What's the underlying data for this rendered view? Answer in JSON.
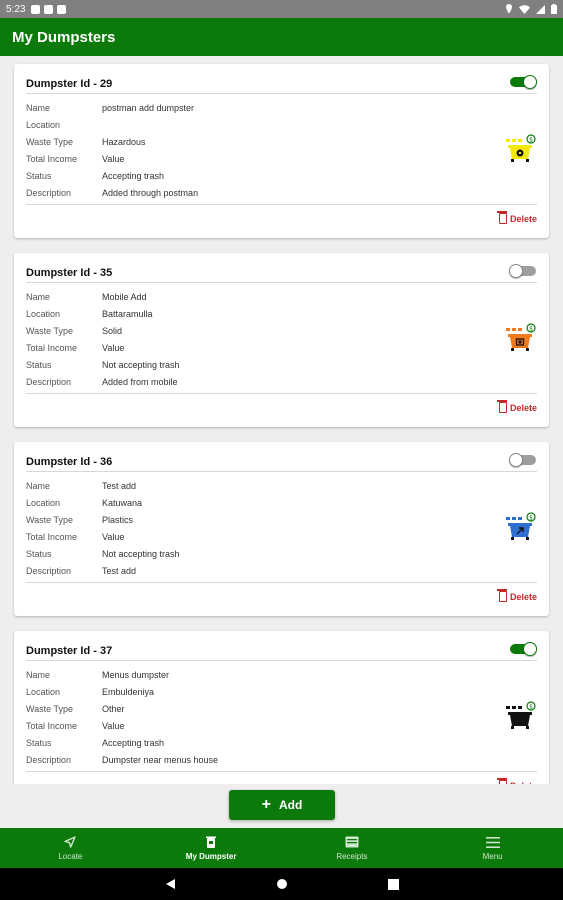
{
  "status_bar": {
    "time": "5:23"
  },
  "app_bar": {
    "title": "My Dumpsters"
  },
  "field_labels": {
    "name": "Name",
    "location": "Location",
    "waste_type": "Waste Type",
    "total_income": "Total Income",
    "status": "Status",
    "description": "Description"
  },
  "delete_label": "Delete",
  "dumpsters": [
    {
      "title": "Dumpster Id - 29",
      "enabled": true,
      "name": "postman add dumpster",
      "location": "",
      "waste_type": "Hazardous",
      "total_income": "Value",
      "status": "Accepting trash",
      "description": "Added through postman",
      "icon": "hazardous-dumpster-icon",
      "color": "#f5e90a"
    },
    {
      "title": "Dumpster Id - 35",
      "enabled": false,
      "name": "Mobile Add",
      "location": "Battaramulla",
      "waste_type": "Solid",
      "total_income": "Value",
      "status": "Not accepting trash",
      "description": "Added from mobile",
      "icon": "solid-dumpster-icon",
      "color": "#f07a1e"
    },
    {
      "title": "Dumpster Id - 36",
      "enabled": false,
      "name": "Test add",
      "location": "Katuwana",
      "waste_type": "Plastics",
      "total_income": "Value",
      "status": "Not accepting trash",
      "description": "Test add",
      "icon": "plastics-dumpster-icon",
      "color": "#2f6fd1"
    },
    {
      "title": "Dumpster Id - 37",
      "enabled": true,
      "name": "Menus dumpster",
      "location": "Embuldeniya",
      "waste_type": "Other",
      "total_income": "Value",
      "status": "Accepting trash",
      "description": "Dumpster near menus house",
      "icon": "other-dumpster-icon",
      "color": "#111111"
    }
  ],
  "add_button": {
    "label": "Add"
  },
  "bottom_nav": [
    {
      "label": "Locate",
      "icon": "navigation-arrow-icon",
      "active": false
    },
    {
      "label": "My Dumpster",
      "icon": "dumpster-icon",
      "active": true
    },
    {
      "label": "Receipts",
      "icon": "receipt-icon",
      "active": false
    },
    {
      "label": "Menu",
      "icon": "menu-icon",
      "active": false
    }
  ],
  "colors": {
    "primary": "#0b7a0b",
    "delete": "#c62828",
    "background": "#eeeeee"
  }
}
